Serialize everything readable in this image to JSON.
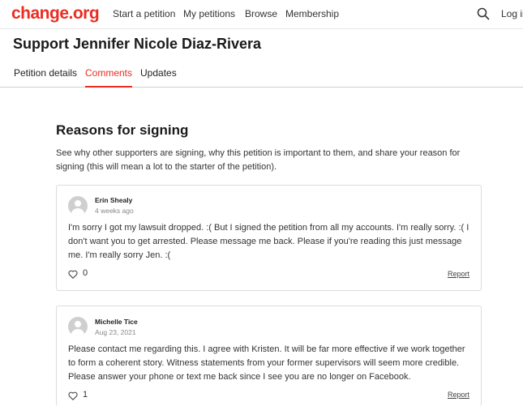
{
  "colors": {
    "brand": "#ec2c22",
    "text": "#1a1a1a",
    "muted": "#888888",
    "border": "#dcdcdc"
  },
  "nav": {
    "logo": "change.org",
    "start_petition": "Start a petition",
    "my_petitions": "My petitions",
    "browse": "Browse",
    "membership": "Membership",
    "search_icon": "search-icon",
    "login": "Log in"
  },
  "page": {
    "title": "Support Jennifer Nicole Diaz-Rivera"
  },
  "tabs": [
    {
      "label": "Petition details",
      "active": false
    },
    {
      "label": "Comments",
      "active": true
    },
    {
      "label": "Updates",
      "active": false
    }
  ],
  "section": {
    "heading": "Reasons for signing",
    "description": "See why other supporters are signing, why this petition is important to them, and share your reason for signing (this will mean a lot to the starter of the petition)."
  },
  "comments": [
    {
      "name": "Erin Shealy",
      "time": "4 weeks ago",
      "text": "I'm sorry I got my lawsuit dropped. :( But I signed the petition from all my accounts. I'm really sorry. :( I don't want you to get arrested. Please message me back. Please if you're reading this just message me. I'm really sorry Jen. :(",
      "likes": "0",
      "report": "Report"
    },
    {
      "name": "Michelle Tice",
      "time": "Aug 23, 2021",
      "text": "Please contact me regarding this. I agree with Kristen. It will be far more effective if we work together to form a coherent story. Witness statements from your former supervisors will seem more credible. Please answer your phone or text me back since I see you are no longer on Facebook.",
      "likes": "1",
      "report": "Report"
    }
  ]
}
